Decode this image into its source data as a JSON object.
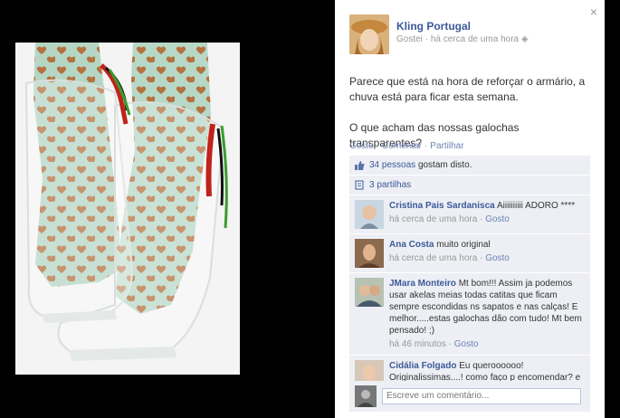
{
  "close_label": "×",
  "post": {
    "author": "Kling Portugal",
    "meta_like": "Gostei",
    "meta_time": "há cerca de uma hora",
    "text_line1": "Parece que está na hora de reforçar o armário, a chuva está para ficar esta semana.",
    "text_line2": "O que acham das nossas galochas transparentes?"
  },
  "actions": {
    "like": "Gosto",
    "comment": "Comentar",
    "share": "Partilhar",
    "separator": "·"
  },
  "feedback": {
    "likes_count": "34 pessoas",
    "likes_suffix": "gostam disto.",
    "shares": "3 partilhas"
  },
  "comments": [
    {
      "name": "Cristina Pais Sardanisca",
      "text": "Aiiiiiiiiii ADORO ****",
      "time": "há cerca de uma hora",
      "like": "Gosto"
    },
    {
      "name": "Ana Costa",
      "text": "muito original",
      "time": "há cerca de uma hora",
      "like": "Gosto"
    },
    {
      "name": "JMara Monteiro",
      "text": "Mt bom!!! Assim ja podemos usar akelas meias todas catitas que ficam sempre escondidas ns sapatos e nas calças! E melhor.....estas galochas dão com tudo! Mt bem pensado! ;)",
      "time": "há 46 minutos",
      "like": "Gosto"
    },
    {
      "name": "Cidália Folgado",
      "text": "Eu queroooooo! Originalissimas....! como faço p encomendar? e quanto custam? Obrigada",
      "time": "",
      "like": ""
    }
  ],
  "comment_input": {
    "placeholder": "Escreve um comentário..."
  },
  "colors": {
    "link": "#3b5998",
    "feedback_bg": "#edeff4"
  }
}
